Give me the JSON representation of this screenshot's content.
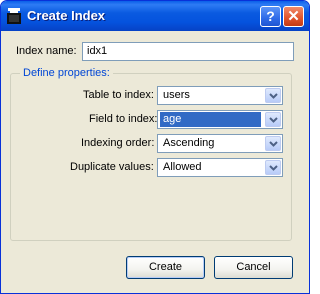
{
  "window": {
    "title": "Create Index",
    "help_glyph": "?",
    "close_glyph": "✕",
    "icon": "window-app-icon"
  },
  "form": {
    "index_name_label": "Index name:",
    "index_name_value": "idx1",
    "group_title": "Define properties:",
    "fields": [
      {
        "label": "Table to index:",
        "value": "users"
      },
      {
        "label": "Field to index:",
        "value": "age"
      },
      {
        "label": "Indexing order:",
        "value": "Ascending"
      },
      {
        "label": "Duplicate values:",
        "value": "Allowed"
      }
    ]
  },
  "buttons": {
    "create": "Create",
    "cancel": "Cancel"
  },
  "colors": {
    "title_gradient_top": "#0a5fe9",
    "dialog_bg": "#ece9d8",
    "group_title": "#0046d5",
    "selection": "#316ac5"
  }
}
